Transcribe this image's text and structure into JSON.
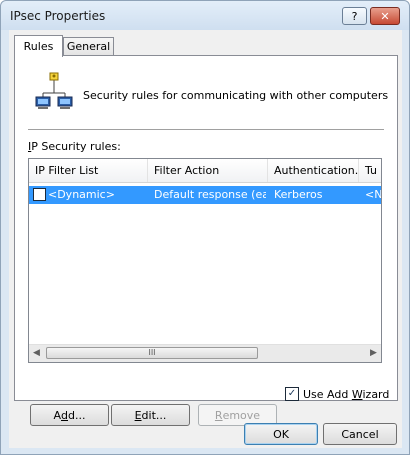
{
  "window": {
    "title": "IPsec Properties",
    "help_label": "?",
    "close_label": "✕"
  },
  "tabs": [
    {
      "label": "Rules"
    },
    {
      "label": "General"
    }
  ],
  "header": {
    "text": "Security rules for communicating with other computers",
    "icon": "network-computers-icon"
  },
  "rules_label": {
    "prefix": "I",
    "rest": "P Security rules:"
  },
  "table": {
    "columns": [
      "IP Filter List",
      "Filter Action",
      "Authentication...",
      "Tu"
    ],
    "rows": [
      {
        "checked": false,
        "filter_list": "<Dynamic>",
        "filter_action": "Default response (ea...",
        "authentication": "Kerberos",
        "tunnel": "<N"
      }
    ],
    "scroll_glyph": "III"
  },
  "buttons": {
    "add": {
      "pre": "A",
      "u": "d",
      "post": "d..."
    },
    "edit": {
      "pre": "",
      "u": "E",
      "post": "dit..."
    },
    "remove": {
      "pre": "",
      "u": "R",
      "post": "emove"
    }
  },
  "wizard": {
    "checked": true,
    "label": "Use Add ",
    "u": "W",
    "label_rest": "izard"
  },
  "footer": {
    "ok_label": "OK",
    "cancel_label": "Cancel"
  }
}
